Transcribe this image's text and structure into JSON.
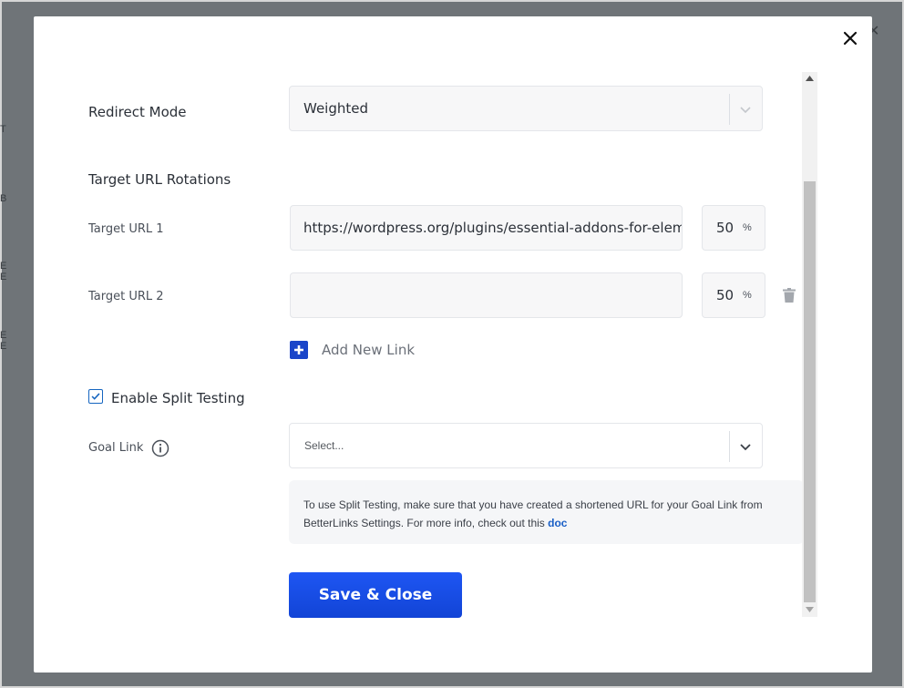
{
  "background": {
    "fragments": [
      "T",
      "B",
      "E",
      "E",
      "E",
      "E"
    ],
    "close_glyph": "✕"
  },
  "modal": {
    "redirect_mode": {
      "label": "Redirect Mode",
      "value": "Weighted"
    },
    "target_rotations": {
      "heading": "Target URL Rotations",
      "rows": [
        {
          "label": "Target URL 1",
          "url": "https://wordpress.org/plugins/essential-addons-for-elementor-lite/",
          "weight": "50",
          "unit": "%"
        },
        {
          "label": "Target URL 2",
          "url": "",
          "weight": "50",
          "unit": "%"
        }
      ],
      "add_link_label": "Add New Link"
    },
    "split_testing": {
      "label": "Enable Split Testing",
      "checked": true
    },
    "goal_link": {
      "label": "Goal Link",
      "placeholder": "Select...",
      "note": "To use Split Testing, make sure that you have created a shortened URL for your Goal Link from BetterLinks Settings. For more info, check out this",
      "note_link": "doc"
    },
    "save_button": "Save & Close"
  },
  "colors": {
    "accent": "#1a45c9",
    "button": "#1e56f3",
    "link": "#1a5fc6"
  }
}
